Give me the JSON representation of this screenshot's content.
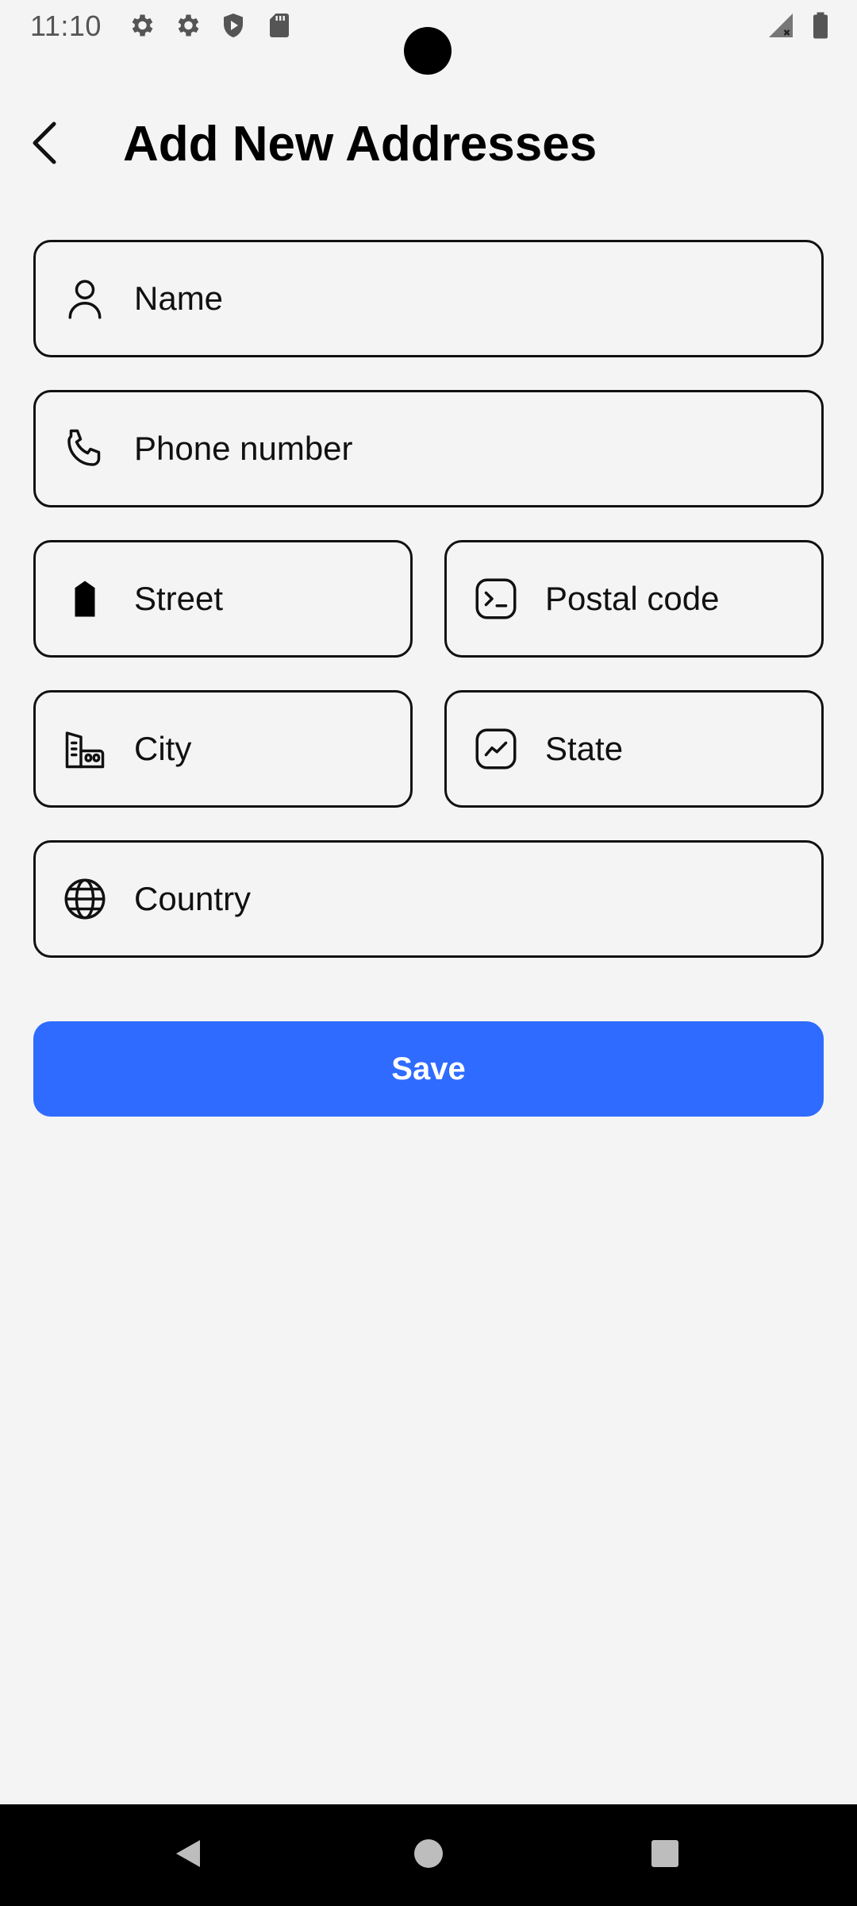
{
  "status_bar": {
    "time": "11:10",
    "icons": [
      "gear-icon",
      "gear-icon",
      "shield-icon",
      "sd-card-icon",
      "signal-icon",
      "battery-icon"
    ]
  },
  "header": {
    "title": "Add New Addresses",
    "back_icon": "chevron-left-icon"
  },
  "form": {
    "name": {
      "placeholder": "Name",
      "icon": "person-icon"
    },
    "phone": {
      "placeholder": "Phone number",
      "icon": "phone-icon"
    },
    "street": {
      "placeholder": "Street",
      "icon": "tag-icon"
    },
    "postal_code": {
      "placeholder": "Postal code",
      "icon": "terminal-icon"
    },
    "city": {
      "placeholder": "City",
      "icon": "buildings-icon"
    },
    "state": {
      "placeholder": "State",
      "icon": "chart-square-icon"
    },
    "country": {
      "placeholder": "Country",
      "icon": "globe-icon"
    }
  },
  "actions": {
    "save_label": "Save"
  },
  "colors": {
    "background": "#f4f4f4",
    "primary": "#2f6bff",
    "border": "#111111",
    "nav_bar": "#000000"
  }
}
